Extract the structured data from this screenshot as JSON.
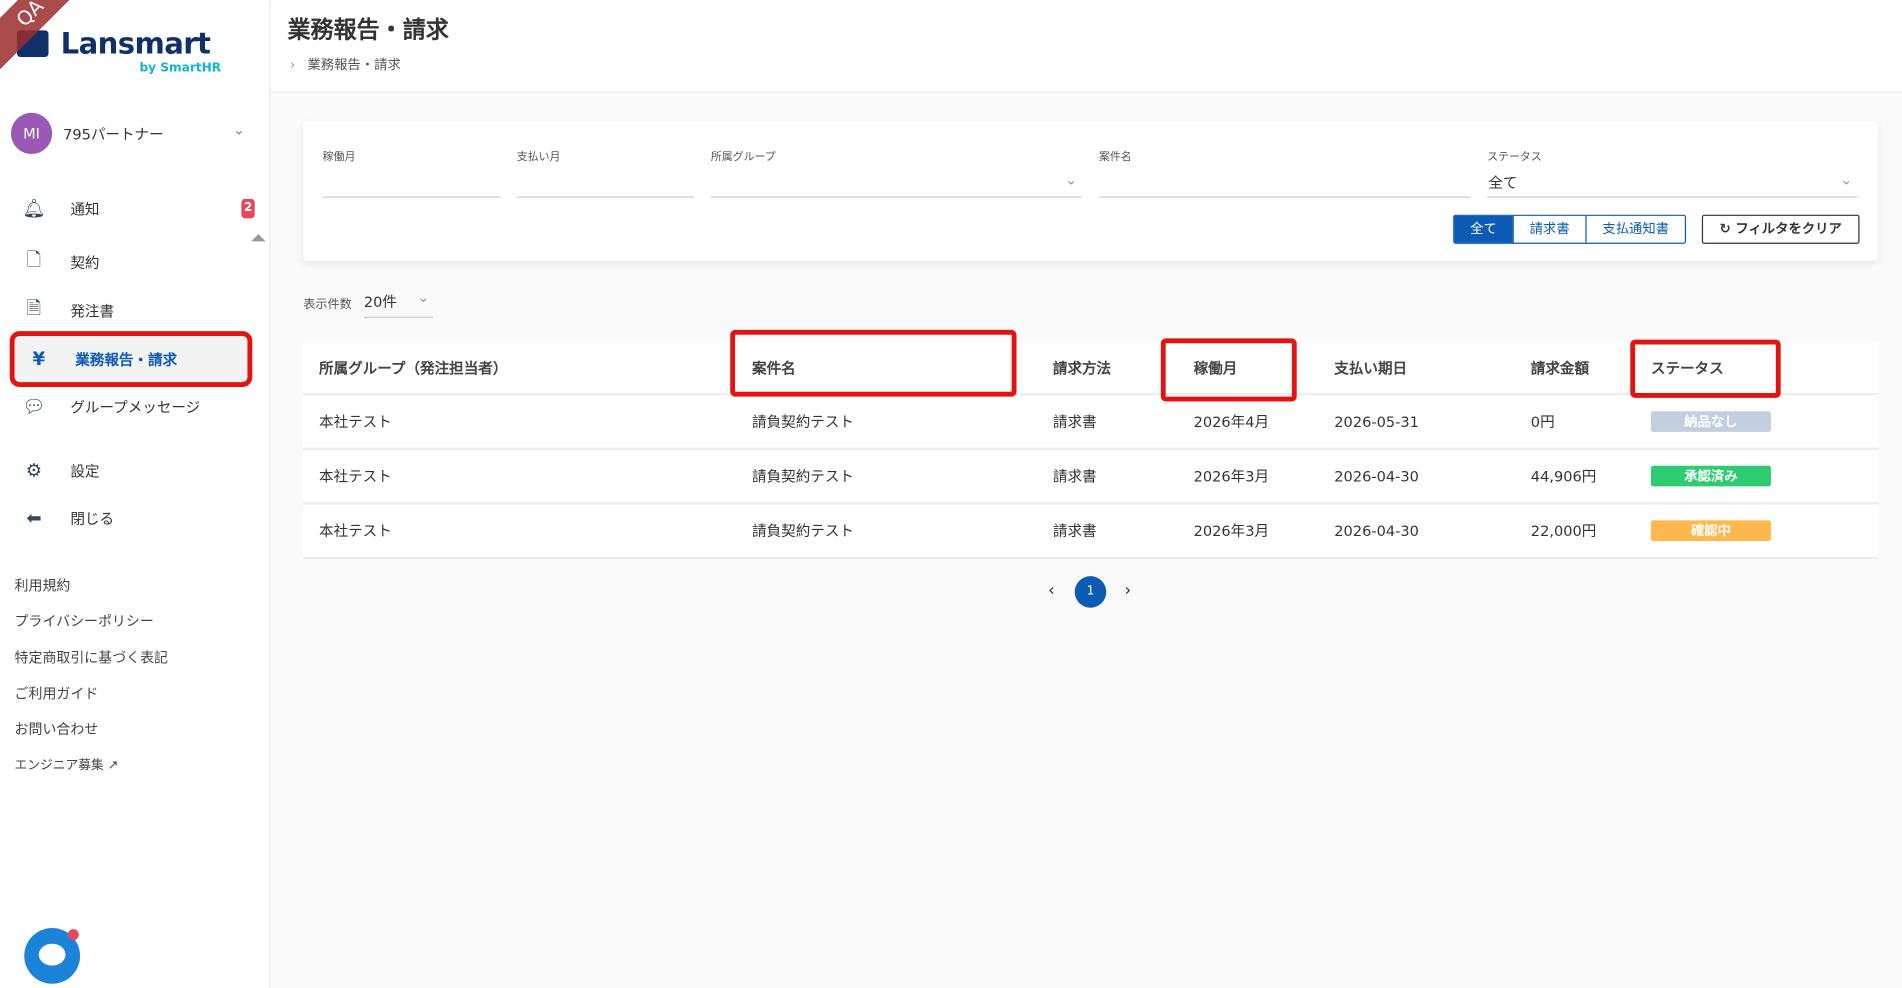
{
  "env_badge": "QA",
  "logo": {
    "main": "Lansmart",
    "sub": "by SmartHR"
  },
  "user": {
    "initials": "MI",
    "name": "795パートナー"
  },
  "nav": [
    {
      "label": "通知",
      "icon": "bell-icon",
      "badge": "2"
    },
    {
      "label": "契約",
      "icon": "contract-icon"
    },
    {
      "label": "発注書",
      "icon": "document-icon"
    },
    {
      "label": "業務報告・請求",
      "icon": "invoice-yen-icon"
    },
    {
      "label": "グループメッセージ",
      "icon": "chat-icon"
    },
    {
      "label": "設定",
      "icon": "gear-icon"
    },
    {
      "label": "閉じる",
      "icon": "arrow-left-circle-icon"
    }
  ],
  "footer_links": [
    "利用規約",
    "プライバシーポリシー",
    "特定商取引に基づく表記",
    "ご利用ガイド",
    "お問い合わせ",
    "エンジニア募集"
  ],
  "header": {
    "title": "業務報告・請求",
    "breadcrumb": "業務報告・請求"
  },
  "filters": {
    "labels": [
      "稼働月",
      "支払い月",
      "所属グループ",
      "案件名",
      "ステータス"
    ],
    "status_value": "全て",
    "types": [
      "全て",
      "請求書",
      "支払通知書"
    ],
    "clear": "フィルタをクリア"
  },
  "page_size": {
    "label": "表示件数",
    "value": "20件"
  },
  "table": {
    "columns": [
      "所属グループ（発注担当者）",
      "案件名",
      "請求方法",
      "稼働月",
      "支払い期日",
      "請求金額",
      "ステータス"
    ],
    "rows": [
      [
        "本社テスト",
        "請負契約テスト",
        "請求書",
        "2026年4月",
        "2026-05-31",
        "0円",
        "納品なし"
      ],
      [
        "本社テスト",
        "請負契約テスト",
        "請求書",
        "2026年3月",
        "2026-04-30",
        "44,906円",
        "承認済み"
      ],
      [
        "本社テスト",
        "請負契約テスト",
        "請求書",
        "2026年3月",
        "2026-04-30",
        "22,000円",
        "確認中"
      ]
    ],
    "status_colors": [
      "#c2cfe0",
      "#2ecc71",
      "#ffb84d"
    ]
  },
  "pagination": {
    "current": "1"
  }
}
